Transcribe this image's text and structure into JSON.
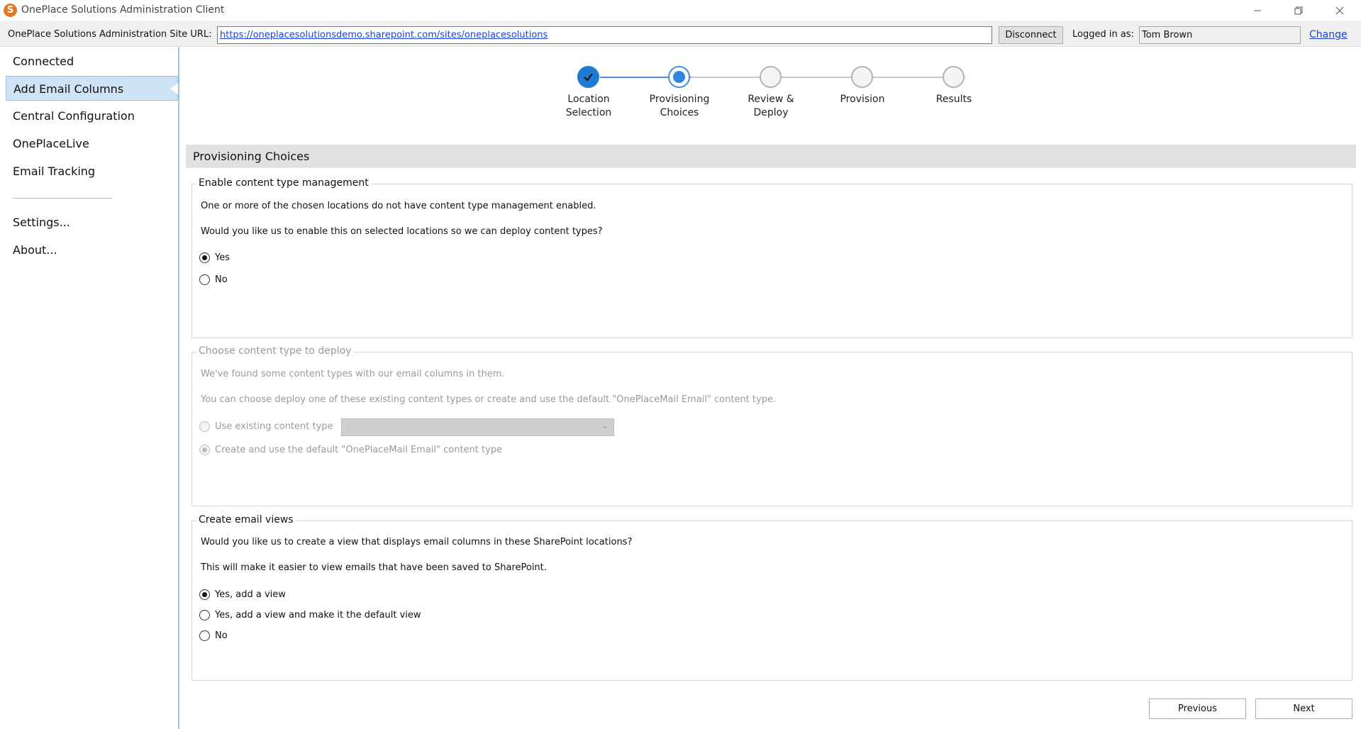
{
  "window": {
    "title": "OnePlace Solutions Administration Client"
  },
  "urlbar": {
    "label": "OnePlace Solutions Administration Site URL:",
    "url": "https://oneplacesolutionsdemo.sharepoint.com/sites/oneplacesolutions",
    "disconnect_label": "Disconnect",
    "logged_in_label": "Logged in as:",
    "user": "Tom Brown",
    "change_label": "Change"
  },
  "sidebar": {
    "items": [
      {
        "label": "Connected"
      },
      {
        "label": "Add Email Columns",
        "active": true
      },
      {
        "label": "Central Configuration"
      },
      {
        "label": "OnePlaceLive"
      },
      {
        "label": "Email Tracking"
      }
    ],
    "settings_label": "Settings...",
    "about_label": "About..."
  },
  "stepper": {
    "steps": [
      {
        "label": "Location Selection",
        "state": "complete"
      },
      {
        "label": "Provisioning Choices",
        "state": "current"
      },
      {
        "label": "Review & Deploy",
        "state": "pending"
      },
      {
        "label": "Provision",
        "state": "pending"
      },
      {
        "label": "Results",
        "state": "pending"
      }
    ]
  },
  "content": {
    "header": "Provisioning Choices",
    "content_type_mgmt": {
      "title": "Enable content type management",
      "line1": "One or more of the chosen locations do not have content type management enabled.",
      "line2": "Would you like us to enable this on selected locations so we can deploy content types?",
      "option_yes": "Yes",
      "option_no": "No",
      "selected": "Yes"
    },
    "content_type_deploy": {
      "title": "Choose content type to deploy",
      "enabled": false,
      "line1": "We've found some content types with our email columns in them.",
      "line2": "You can choose deploy one of these existing content types or create and use the default \"OnePlaceMail Email\" content type.",
      "option_existing": "Use existing content type",
      "option_default": "Create and use the default \"OnePlaceMail Email\" content type",
      "selected": "default",
      "dropdown_value": ""
    },
    "email_views": {
      "title": "Create email views",
      "line1": "Would you like us to create a view that displays email columns in these SharePoint locations?",
      "line2": "This will make it easier to view emails that have been saved to SharePoint.",
      "option_add": "Yes, add a view",
      "option_add_default": "Yes, add a view and make it the default view",
      "option_no": "No",
      "selected": "add"
    }
  },
  "footer": {
    "previous_label": "Previous",
    "next_label": "Next"
  },
  "colors": {
    "accent": "#1e7ad3",
    "sidebar_active": "#cfe3f6",
    "link": "#1a3fd6"
  }
}
